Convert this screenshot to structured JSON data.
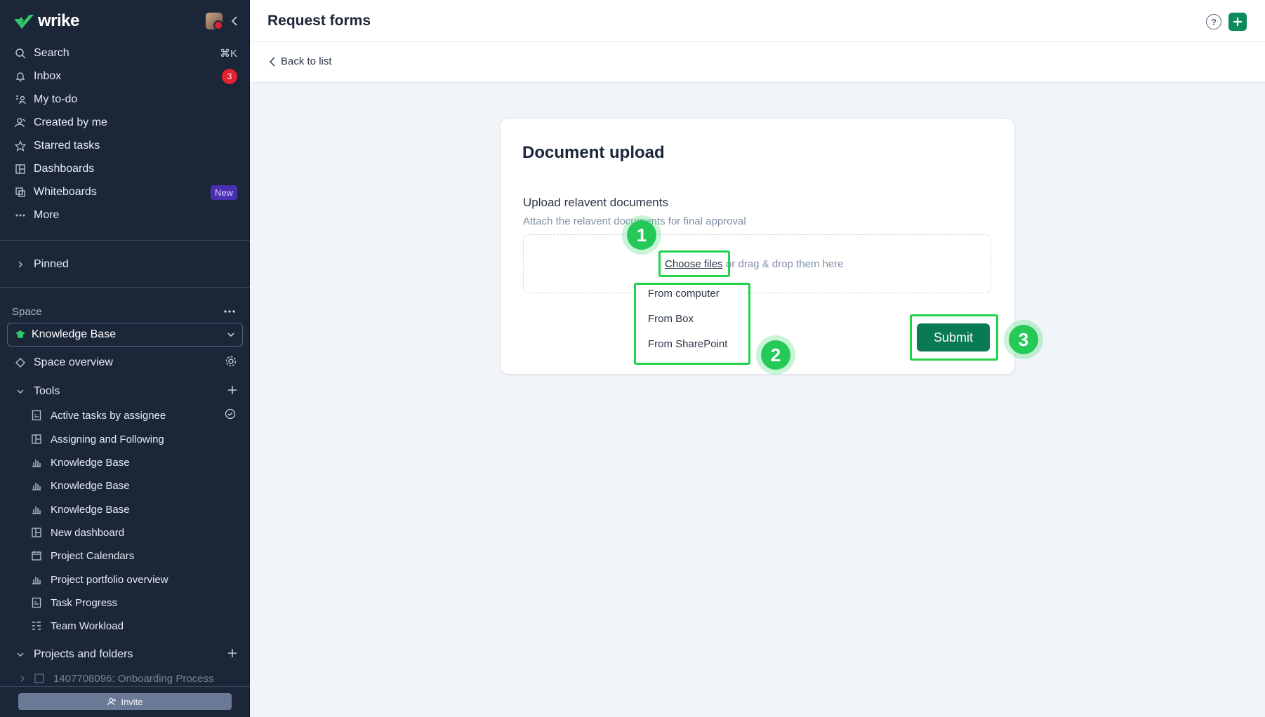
{
  "app": {
    "logo_text": "wrike"
  },
  "sidebar": {
    "nav": [
      {
        "label": "Search",
        "shortcut": "⌘K",
        "icon": "search-icon"
      },
      {
        "label": "Inbox",
        "badge": "3",
        "icon": "bell-icon"
      },
      {
        "label": "My to-do",
        "icon": "todo-icon"
      },
      {
        "label": "Created by me",
        "icon": "user-icon"
      },
      {
        "label": "Starred tasks",
        "icon": "star-icon"
      },
      {
        "label": "Dashboards",
        "icon": "dashboard-icon"
      },
      {
        "label": "Whiteboards",
        "badge": "New",
        "icon": "whiteboard-icon"
      },
      {
        "label": "More",
        "icon": "more-icon"
      }
    ],
    "pinned_label": "Pinned",
    "space_label": "Space",
    "space_selected": "Knowledge Base",
    "space_overview": "Space overview",
    "tools_label": "Tools",
    "tools": [
      {
        "label": "Active tasks by assignee",
        "icon": "report-icon"
      },
      {
        "label": "Assigning and Following",
        "icon": "dashboard-icon"
      },
      {
        "label": "Knowledge Base",
        "icon": "chart-icon"
      },
      {
        "label": "Knowledge Base",
        "icon": "chart-icon"
      },
      {
        "label": "Knowledge Base",
        "icon": "chart-icon"
      },
      {
        "label": "New dashboard",
        "icon": "dashboard-icon"
      },
      {
        "label": "Project Calendars",
        "icon": "calendar-icon"
      },
      {
        "label": "Project portfolio overview",
        "icon": "chart-icon"
      },
      {
        "label": "Task Progress",
        "icon": "report-icon"
      },
      {
        "label": "Team Workload",
        "icon": "workload-icon"
      }
    ],
    "projects_label": "Projects and folders",
    "project_item": "1407708096: Onboarding Process",
    "invite_label": "Invite"
  },
  "header": {
    "title": "Request forms",
    "back_label": "Back to list"
  },
  "form": {
    "title": "Document upload",
    "field_label": "Upload relavent documents",
    "field_desc": "Attach the relavent documents for final approval",
    "choose_files": "Choose files",
    "drop_hint": "or drag & drop them here",
    "menu": [
      "From computer",
      "From Box",
      "From SharePoint"
    ],
    "submit": "Submit"
  },
  "steps": [
    "1",
    "2",
    "3"
  ],
  "colors": {
    "sidebar_bg": "#1b2639",
    "accent": "#0a7a52",
    "highlight": "#1fd34b",
    "badge_red": "#e3212f",
    "badge_new": "#4a2fb0"
  }
}
